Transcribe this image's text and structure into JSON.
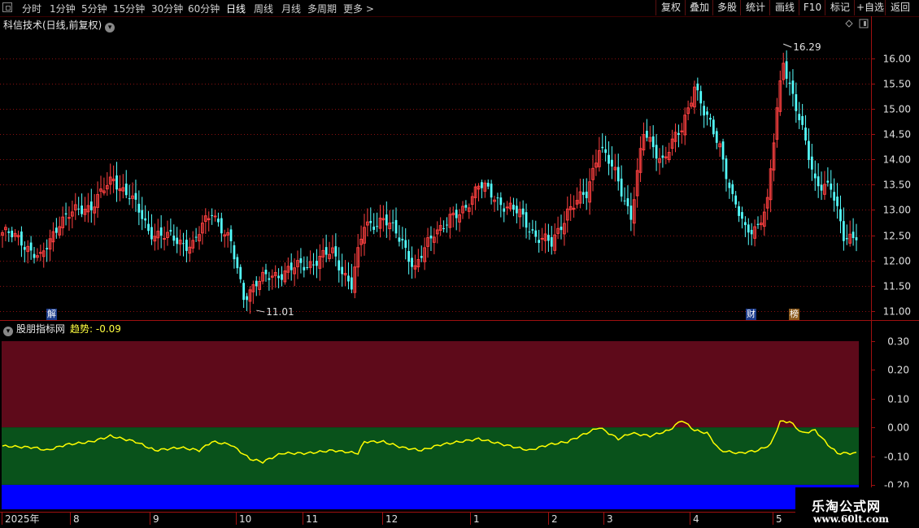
{
  "toolbar": {
    "periods": [
      "分时",
      "1分钟",
      "5分钟",
      "15分钟",
      "30分钟",
      "60分钟",
      "日线",
      "周线",
      "月线",
      "多周期",
      "更多 >"
    ],
    "active_period": "日线",
    "buttons": [
      "复权",
      "叠加",
      "多股",
      "统计",
      "画线",
      "F10",
      "标记",
      "+自选",
      "返回"
    ]
  },
  "main_chart": {
    "title": "科信技术(日线,前复权)",
    "high_label": "16.29",
    "low_label": "11.01",
    "badges": [
      "解",
      "财",
      "榜"
    ]
  },
  "indicator": {
    "name": "股朋指标网",
    "series_label": "趋势:",
    "series_value": "-0.09"
  },
  "x_axis": {
    "labels": [
      "2025年",
      "8",
      "9",
      "10",
      "11",
      "12",
      "1",
      "2",
      "3",
      "4",
      "5"
    ]
  },
  "watermark": {
    "title": "乐淘公式网",
    "url": "www.60lt.com"
  },
  "chart_data": [
    {
      "type": "candlestick",
      "y_ticks": [
        11.0,
        11.5,
        12.0,
        12.5,
        13.0,
        13.5,
        14.0,
        14.5,
        15.0,
        15.5,
        16.0
      ],
      "ylim": [
        10.85,
        16.55
      ],
      "grid": "horizontal-dotted",
      "colors": {
        "up": "#ff4040",
        "down": "#54ffff"
      },
      "annotated_extremes": {
        "high": 16.29,
        "low": 11.01
      },
      "anchors": [
        {
          "i": 0,
          "c": 12.55
        },
        {
          "i": 6,
          "c": 12.4
        },
        {
          "i": 12,
          "c": 12.0
        },
        {
          "i": 18,
          "c": 12.8
        },
        {
          "i": 28,
          "c": 13.1
        },
        {
          "i": 35,
          "c": 13.6
        },
        {
          "i": 40,
          "c": 13.3
        },
        {
          "i": 46,
          "c": 12.6
        },
        {
          "i": 52,
          "c": 12.45
        },
        {
          "i": 60,
          "c": 12.3
        },
        {
          "i": 66,
          "c": 13.0
        },
        {
          "i": 72,
          "c": 12.3
        },
        {
          "i": 76,
          "c": 11.3
        },
        {
          "i": 80,
          "c": 11.55
        },
        {
          "i": 85,
          "c": 11.7
        },
        {
          "i": 95,
          "c": 11.9
        },
        {
          "i": 104,
          "c": 12.15
        },
        {
          "i": 110,
          "c": 11.5
        },
        {
          "i": 114,
          "c": 12.7
        },
        {
          "i": 120,
          "c": 12.8
        },
        {
          "i": 126,
          "c": 12.4
        },
        {
          "i": 130,
          "c": 11.8
        },
        {
          "i": 136,
          "c": 12.6
        },
        {
          "i": 144,
          "c": 12.9
        },
        {
          "i": 150,
          "c": 13.5
        },
        {
          "i": 156,
          "c": 13.2
        },
        {
          "i": 163,
          "c": 12.9
        },
        {
          "i": 168,
          "c": 12.5
        },
        {
          "i": 173,
          "c": 12.3
        },
        {
          "i": 178,
          "c": 13.0
        },
        {
          "i": 184,
          "c": 13.3
        },
        {
          "i": 188,
          "c": 14.3
        },
        {
          "i": 193,
          "c": 13.7
        },
        {
          "i": 198,
          "c": 12.9
        },
        {
          "i": 202,
          "c": 14.5
        },
        {
          "i": 208,
          "c": 14.0
        },
        {
          "i": 214,
          "c": 14.6
        },
        {
          "i": 218,
          "c": 15.5
        },
        {
          "i": 221,
          "c": 14.9
        },
        {
          "i": 226,
          "c": 14.3
        },
        {
          "i": 230,
          "c": 13.2
        },
        {
          "i": 234,
          "c": 12.6
        },
        {
          "i": 238,
          "c": 12.7
        },
        {
          "i": 241,
          "c": 13.1
        },
        {
          "i": 244,
          "c": 15.0
        },
        {
          "i": 246,
          "c": 16.0
        },
        {
          "i": 250,
          "c": 15.0
        },
        {
          "i": 256,
          "c": 13.6
        },
        {
          "i": 261,
          "c": 13.4
        },
        {
          "i": 265,
          "c": 12.5
        }
      ]
    },
    {
      "type": "line",
      "series": [
        {
          "name": "趋势",
          "color": "#ffff00"
        }
      ],
      "y_ticks": [
        0.3,
        0.2,
        0.1,
        -0.0,
        -0.1,
        -0.2
      ],
      "ylim": [
        -0.285,
        0.345
      ],
      "bands": [
        {
          "from": 0.3,
          "to": 0.0,
          "color": "#5e0a1a"
        },
        {
          "from": 0.0,
          "to": -0.2,
          "color": "#09521b"
        },
        {
          "from": -0.2,
          "to": -0.3,
          "color": "#0000ff"
        }
      ],
      "points": [
        [
          0,
          -0.065
        ],
        [
          10,
          -0.07
        ],
        [
          14,
          -0.08
        ],
        [
          20,
          -0.06
        ],
        [
          28,
          -0.05
        ],
        [
          34,
          -0.03
        ],
        [
          42,
          -0.05
        ],
        [
          48,
          -0.08
        ],
        [
          56,
          -0.07
        ],
        [
          62,
          -0.08
        ],
        [
          66,
          -0.05
        ],
        [
          72,
          -0.06
        ],
        [
          78,
          -0.11
        ],
        [
          82,
          -0.12
        ],
        [
          88,
          -0.09
        ],
        [
          96,
          -0.09
        ],
        [
          104,
          -0.08
        ],
        [
          112,
          -0.09
        ],
        [
          114,
          -0.05
        ],
        [
          120,
          -0.05
        ],
        [
          126,
          -0.07
        ],
        [
          132,
          -0.08
        ],
        [
          138,
          -0.06
        ],
        [
          144,
          -0.05
        ],
        [
          150,
          -0.04
        ],
        [
          158,
          -0.06
        ],
        [
          166,
          -0.08
        ],
        [
          172,
          -0.06
        ],
        [
          178,
          -0.05
        ],
        [
          184,
          -0.02
        ],
        [
          188,
          0.0
        ],
        [
          194,
          -0.04
        ],
        [
          198,
          -0.02
        ],
        [
          204,
          -0.03
        ],
        [
          210,
          -0.01
        ],
        [
          214,
          0.025
        ],
        [
          218,
          -0.01
        ],
        [
          222,
          -0.02
        ],
        [
          226,
          -0.08
        ],
        [
          232,
          -0.09
        ],
        [
          238,
          -0.08
        ],
        [
          242,
          -0.06
        ],
        [
          245,
          0.02
        ],
        [
          248,
          0.02
        ],
        [
          252,
          -0.02
        ],
        [
          256,
          -0.01
        ],
        [
          260,
          -0.06
        ],
        [
          263,
          -0.09
        ],
        [
          267,
          -0.09
        ]
      ]
    }
  ]
}
